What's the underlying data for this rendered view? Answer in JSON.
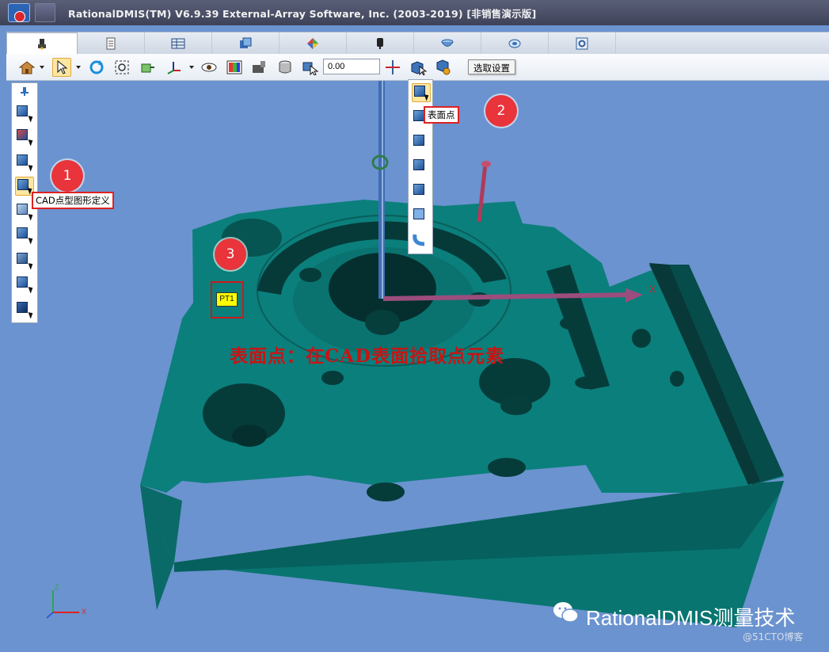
{
  "window": {
    "title": "RationalDMIS(TM) V6.9.39    External-Array Software, Inc. (2003-2019) [非销售演示版]"
  },
  "tabs": [
    {
      "icon": "probe-icon",
      "active": true
    },
    {
      "icon": "document-icon"
    },
    {
      "icon": "table-icon"
    },
    {
      "icon": "report-icon"
    },
    {
      "icon": "color-palette-icon"
    },
    {
      "icon": "probe-head-icon"
    },
    {
      "icon": "bowl-icon"
    },
    {
      "icon": "disc-icon"
    },
    {
      "icon": "settings-icon"
    }
  ],
  "toolbar": {
    "numeric_value": "0.00",
    "tooltip": "选取设置"
  },
  "left_toolbar": {
    "tooltip": "CAD点型图形定义",
    "items": [
      "no-select-icon",
      "point-select-icon",
      "edge-select-icon",
      "cad-point-icon",
      "multi-select-icon",
      "line-select-icon",
      "surface-select-icon",
      "section-select-icon",
      "d-select-icon"
    ]
  },
  "popup": {
    "tooltip": "表面点",
    "items": [
      "surface-point-icon",
      "edge-point-icon",
      "corner-point-icon",
      "vector-point-icon",
      "angle-point-icon",
      "sheet-point-icon",
      "curve-point-icon"
    ]
  },
  "annotations": {
    "callout_1": "1",
    "callout_2": "2",
    "callout_3": "3",
    "point_label": "PT1",
    "caption": "表面点：在CAD表面拾取点元素"
  },
  "viewport": {
    "x_axis_label": "X",
    "mini_axis_z": "Z",
    "mini_axis_x": "X",
    "background_color": "#6b93cf",
    "part_color": "#0b7f7c"
  },
  "watermark": {
    "text": "RationalDMIS测量技术",
    "subtext": "@51CTO博客"
  }
}
